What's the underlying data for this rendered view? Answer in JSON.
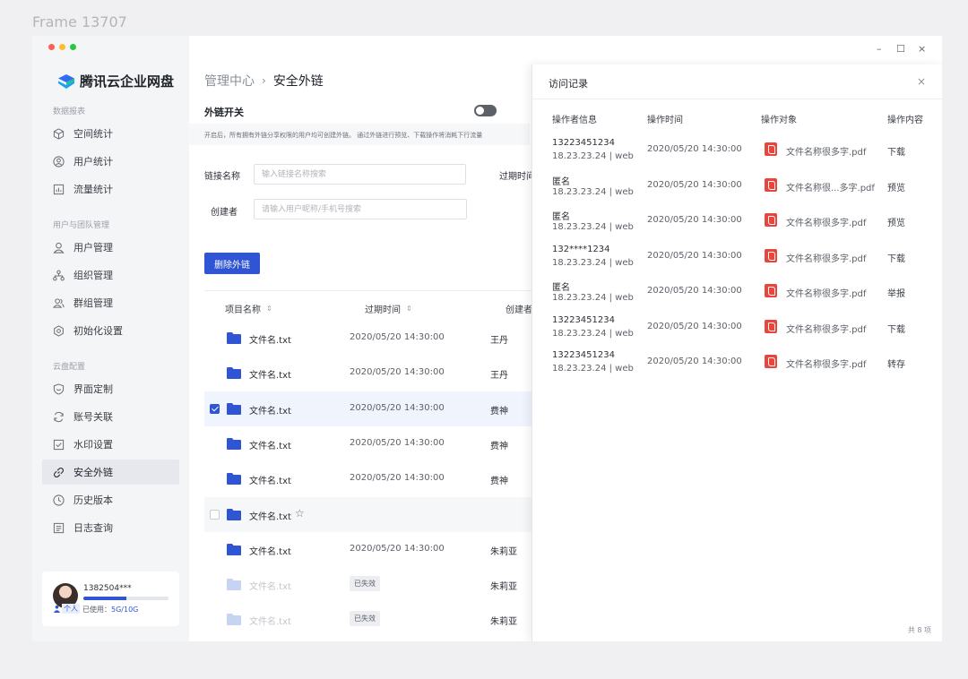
{
  "frame_label": "Frame 13707",
  "colors": {
    "accent": "#2f55d4",
    "pdf": "#e8453c",
    "sidebar_bg": "#f4f5f7"
  },
  "app": {
    "name": "腾讯云企业网盘",
    "logo_icon": "tencent-cloud-logo-icon"
  },
  "sidebar": {
    "groups": [
      {
        "label": "数据报表",
        "items": [
          {
            "label": "空间统计",
            "icon": "cube-icon"
          },
          {
            "label": "用户统计",
            "icon": "user-circle-icon"
          },
          {
            "label": "流量统计",
            "icon": "bar-chart-icon"
          }
        ]
      },
      {
        "label": "用户与团队管理",
        "items": [
          {
            "label": "用户管理",
            "icon": "user-icon"
          },
          {
            "label": "组织管理",
            "icon": "org-chart-icon"
          },
          {
            "label": "群组管理",
            "icon": "users-icon"
          },
          {
            "label": "初始化设置",
            "icon": "gear-icon"
          }
        ]
      },
      {
        "label": "云盘配置",
        "items": [
          {
            "label": "界面定制",
            "icon": "shield-icon"
          },
          {
            "label": "账号关联",
            "icon": "sync-icon"
          },
          {
            "label": "水印设置",
            "icon": "checkbox-icon"
          },
          {
            "label": "安全外链",
            "icon": "link-icon",
            "active": true
          },
          {
            "label": "历史版本",
            "icon": "clock-icon"
          },
          {
            "label": "日志查询",
            "icon": "list-icon"
          }
        ]
      }
    ],
    "user": {
      "name": "1382504***",
      "tag": "个人",
      "usage_prefix": "已使用：",
      "usage_value": "5G/10G",
      "usage_fraction": 0.5
    }
  },
  "window_controls": {
    "minimize": "–",
    "maximize": "☐",
    "close": "×"
  },
  "breadcrumb": {
    "parent": "管理中心",
    "separator": "›",
    "current": "安全外链"
  },
  "switch": {
    "label": "外链开关",
    "on": false,
    "description": "开启后，所有拥有外链分享权限的用户均可创建外链。 通过外链进行预览、下载操作将消耗下行流量"
  },
  "filters": {
    "link_name": {
      "label": "链接名称",
      "placeholder": "输入链接名称搜索"
    },
    "creator": {
      "label": "创建者",
      "placeholder": "请输入用户昵称/手机号搜索"
    },
    "expire_label": "过期时间"
  },
  "delete_button": "删除外链",
  "table": {
    "columns": [
      "项目名称",
      "过期时间",
      "创建者"
    ],
    "rows": [
      {
        "name": "文件名.txt",
        "time": "2020/05/20 14:30:00",
        "creator": "王丹",
        "state": "normal",
        "checked": false
      },
      {
        "name": "文件名.txt",
        "time": "2020/05/20 14:30:00",
        "creator": "王丹",
        "state": "normal",
        "checked": false
      },
      {
        "name": "文件名.txt",
        "time": "2020/05/20 14:30:00",
        "creator": "费神",
        "state": "normal",
        "checked": true
      },
      {
        "name": "文件名.txt",
        "time": "2020/05/20 14:30:00",
        "creator": "费神",
        "state": "normal",
        "checked": false
      },
      {
        "name": "文件名.txt",
        "time": "2020/05/20 14:30:00",
        "creator": "费神",
        "state": "normal",
        "checked": false
      },
      {
        "name": "文件名.txt",
        "time": "",
        "creator": "",
        "state": "hover",
        "checked": false,
        "star": "☆"
      },
      {
        "name": "文件名.txt",
        "time": "2020/05/20 14:30:00",
        "creator": "朱莉亚",
        "state": "normal",
        "checked": false
      },
      {
        "name": "文件名.txt",
        "time": "已失效",
        "creator": "朱莉亚",
        "state": "expired",
        "checked": false
      },
      {
        "name": "文件名.txt",
        "time": "已失效",
        "creator": "朱莉亚",
        "state": "expired",
        "checked": false
      }
    ]
  },
  "panel": {
    "title": "访问记录",
    "close": "×",
    "columns": [
      "操作者信息",
      "操作时间",
      "操作对象",
      "操作内容"
    ],
    "rows": [
      {
        "operator": "13223451234",
        "ip": "18.23.23.24 | web",
        "time": "2020/05/20 14:30:00",
        "file": "文件名称很多字.pdf",
        "action": "下载"
      },
      {
        "operator": "匿名",
        "ip": "18.23.23.24 | web",
        "time": "2020/05/20 14:30:00",
        "file": "文件名称很...多字.pdf",
        "action": "预览"
      },
      {
        "operator": "匿名",
        "ip": "18.23.23.24 | web",
        "time": "2020/05/20 14:30:00",
        "file": "文件名称很多字.pdf",
        "action": "预览"
      },
      {
        "operator": "132****1234",
        "ip": "18.23.23.24 | web",
        "time": "2020/05/20 14:30:00",
        "file": "文件名称很多字.pdf",
        "action": "下载"
      },
      {
        "operator": "匿名",
        "ip": "18.23.23.24 | web",
        "time": "2020/05/20 14:30:00",
        "file": "文件名称很多字.pdf",
        "action": "举报"
      },
      {
        "operator": "13223451234",
        "ip": "18.23.23.24 | web",
        "time": "2020/05/20 14:30:00",
        "file": "文件名称很多字.pdf",
        "action": "下载"
      },
      {
        "operator": "13223451234",
        "ip": "18.23.23.24 | web",
        "time": "2020/05/20 14:30:00",
        "file": "文件名称很多字.pdf",
        "action": "转存"
      }
    ],
    "total": "共 8 项"
  }
}
